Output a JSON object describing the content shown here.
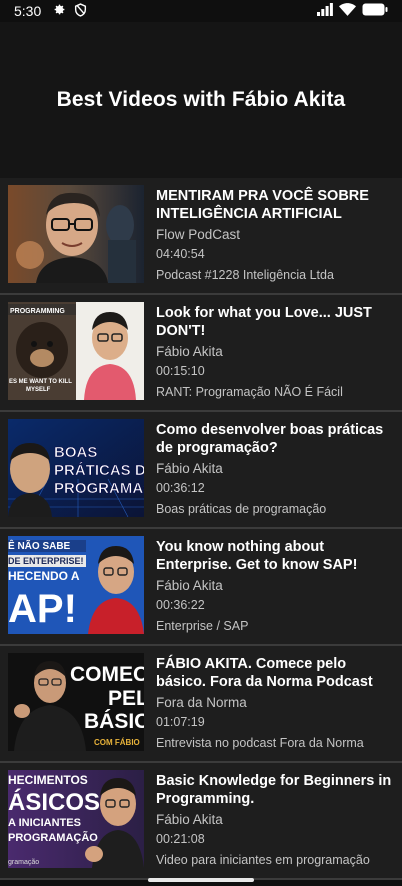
{
  "status_bar": {
    "time": "5:30"
  },
  "header": {
    "title": "Best Videos with Fábio Akita"
  },
  "videos": [
    {
      "title": "MENTIRAM PRA VOCÊ SOBRE INTELIGÊNCIA ARTIFICIAL",
      "channel": "Flow PodCast",
      "duration": "04:40:54",
      "description": "Podcast #1228 Inteligência Ltda"
    },
    {
      "title": "Look for what you Love... JUST DON'T!",
      "channel": "Fábio Akita",
      "duration": "00:15:10",
      "description": "RANT: Programação NÃO É Fácil",
      "thumb_text": {
        "top": "PROGRAMMING",
        "bottom1": "ES ME WANT TO KILL",
        "bottom2": "MYSELF"
      }
    },
    {
      "title": "Como desenvolver boas práticas de programação?",
      "channel": "Fábio Akita",
      "duration": "00:36:12",
      "description": "Boas práticas de programação",
      "thumb_text": {
        "l1": "BOAS",
        "l2": "PRÁTICAS DE",
        "l3": "PROGRAMAÇ"
      }
    },
    {
      "title": "You know nothing about Enterprise. Get to know SAP!",
      "channel": "Fábio Akita",
      "duration": "00:36:22",
      "description": "Enterprise / SAP",
      "thumb_text": {
        "l1": "Ê NÃO SABE",
        "l2": "DE ENTERPRISE!",
        "l3": "HECENDO A",
        "l4": "AP!"
      }
    },
    {
      "title": "FÁBIO AKITA. Comece pelo básico. Fora da Norma Podcast",
      "channel": "Fora da Norma",
      "duration": "01:07:19",
      "description": "Entrevista no podcast Fora da Norma",
      "thumb_text": {
        "l1": "COMEC",
        "l2": "PEL",
        "l3": "BÁSIC",
        "l4": "COM FÁBIO"
      }
    },
    {
      "title": "Basic Knowledge for Beginners in Programming.",
      "channel": "Fábio Akita",
      "duration": "00:21:08",
      "description": "Video para iniciantes em programação",
      "thumb_text": {
        "l1": "HECIMENTOS",
        "l2": "ÁSICOS",
        "l3": "A INICIANTES",
        "l4": "PROGRAMAÇÃO",
        "l5": "gramação"
      }
    }
  ],
  "colors": {
    "background": "#0f0f0f",
    "header": "#151515",
    "item": "#1e1e1e",
    "divider": "#3b3b3b",
    "text_secondary": "#c4c4c4"
  },
  "icons": [
    "gear-icon",
    "shield-icon",
    "signal-icon",
    "wifi-icon",
    "battery-icon"
  ]
}
